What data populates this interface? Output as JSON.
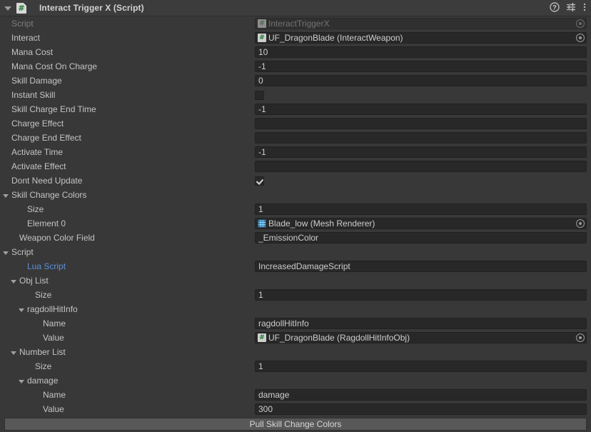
{
  "header": {
    "title": "Interact Trigger X (Script)",
    "script_icon": "csharp-script-icon",
    "foldout_expanded": true,
    "tools": [
      {
        "name": "help-icon",
        "label": "?"
      },
      {
        "name": "preset-icon",
        "label": ""
      },
      {
        "name": "more-menu-icon",
        "label": ""
      }
    ]
  },
  "colors": {
    "window_bg": "#383838",
    "header_bg": "#3c3c3c",
    "field_bg": "#282828",
    "text": "#c4c4c4",
    "text_disabled": "#7d7d7d",
    "link": "#5b8fd9",
    "button_bg": "#585858"
  },
  "rows": [
    {
      "label": "Script",
      "indent": 0,
      "disabled": true,
      "field": {
        "type": "objref",
        "value": "InteractTriggerX",
        "icon": "script-icon",
        "icon_dim": true,
        "picker": true,
        "picker_dim": true
      }
    },
    {
      "label": "Interact",
      "indent": 0,
      "field": {
        "type": "objref",
        "value": "UF_DragonBlade (InteractWeapon)",
        "icon": "script-icon",
        "picker": true
      }
    },
    {
      "label": "Mana Cost",
      "indent": 0,
      "field": {
        "type": "text",
        "value": "10"
      }
    },
    {
      "label": "Mana Cost On Charge",
      "indent": 0,
      "field": {
        "type": "text",
        "value": "-1"
      }
    },
    {
      "label": "Skill Damage",
      "indent": 0,
      "field": {
        "type": "text",
        "value": "0"
      }
    },
    {
      "label": "Instant Skill",
      "indent": 0,
      "field": {
        "type": "checkbox",
        "checked": false
      }
    },
    {
      "label": "Skill Charge End Time",
      "indent": 0,
      "field": {
        "type": "text",
        "value": "-1"
      }
    },
    {
      "label": "Charge Effect",
      "indent": 0,
      "field": {
        "type": "text",
        "value": ""
      }
    },
    {
      "label": "Charge End Effect",
      "indent": 0,
      "field": {
        "type": "text",
        "value": ""
      }
    },
    {
      "label": "Activate Time",
      "indent": 0,
      "field": {
        "type": "text",
        "value": "-1"
      }
    },
    {
      "label": "Activate Effect",
      "indent": 0,
      "field": {
        "type": "text",
        "value": ""
      }
    },
    {
      "label": "Dont Need Update",
      "indent": 0,
      "field": {
        "type": "checkbox",
        "checked": true
      }
    },
    {
      "label": "Skill Change Colors",
      "indent": 0,
      "foldout": true,
      "field": {
        "type": "none"
      }
    },
    {
      "label": "Size",
      "indent": 2,
      "field": {
        "type": "text",
        "value": "1"
      }
    },
    {
      "label": "Element 0",
      "indent": 2,
      "field": {
        "type": "objref",
        "value": "Blade_low (Mesh Renderer)",
        "icon": "mesh-renderer-icon",
        "picker": true
      }
    },
    {
      "label": "Weapon Color Field",
      "indent": 1,
      "field": {
        "type": "text",
        "value": "_EmissionColor"
      }
    },
    {
      "label": "Script",
      "indent": 0,
      "foldout": true,
      "field": {
        "type": "none"
      }
    },
    {
      "label": "Lua Script",
      "indent": 2,
      "link": true,
      "field": {
        "type": "text",
        "value": "IncreasedDamageScript"
      }
    },
    {
      "label": "Obj List",
      "indent": 1,
      "foldout": true,
      "field": {
        "type": "none"
      }
    },
    {
      "label": "Size",
      "indent": 3,
      "field": {
        "type": "text",
        "value": "1"
      }
    },
    {
      "label": "ragdollHitInfo",
      "indent": 2,
      "foldout": true,
      "field": {
        "type": "none"
      }
    },
    {
      "label": "Name",
      "indent": 4,
      "field": {
        "type": "text",
        "value": "ragdollHitInfo"
      }
    },
    {
      "label": "Value",
      "indent": 4,
      "field": {
        "type": "objref",
        "value": "UF_DragonBlade (RagdollHitInfoObj)",
        "icon": "script-icon",
        "picker": true
      }
    },
    {
      "label": "Number List",
      "indent": 1,
      "foldout": true,
      "field": {
        "type": "none"
      }
    },
    {
      "label": "Size",
      "indent": 3,
      "field": {
        "type": "text",
        "value": "1"
      }
    },
    {
      "label": "damage",
      "indent": 2,
      "foldout": true,
      "field": {
        "type": "none"
      }
    },
    {
      "label": "Name",
      "indent": 4,
      "field": {
        "type": "text",
        "value": "damage"
      }
    },
    {
      "label": "Value",
      "indent": 4,
      "field": {
        "type": "text",
        "value": "300"
      }
    }
  ],
  "footer": {
    "button_label": "Pull Skill Change Colors"
  }
}
